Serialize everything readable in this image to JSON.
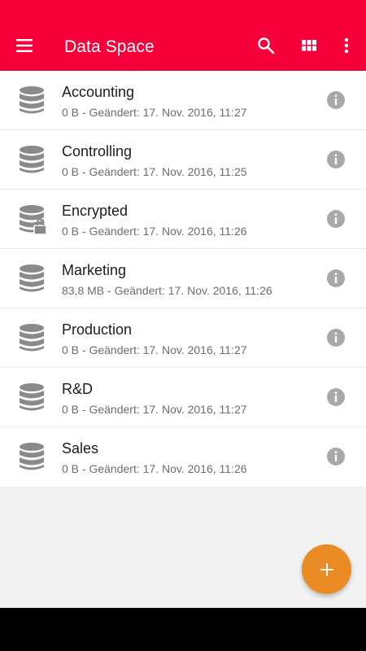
{
  "app_bar": {
    "title": "Data Space",
    "background": "#f5003b",
    "icons": [
      "menu-icon",
      "search-icon",
      "grid-view-icon",
      "more-vert-icon"
    ]
  },
  "spaces": [
    {
      "name": "Accounting",
      "meta": "0 B - Geändert: 17. Nov. 2016, 11:27",
      "encrypted": false
    },
    {
      "name": "Controlling",
      "meta": "0 B - Geändert: 17. Nov. 2016, 11:25",
      "encrypted": false
    },
    {
      "name": "Encrypted",
      "meta": "0 B - Geändert: 17. Nov. 2016, 11:26",
      "encrypted": true
    },
    {
      "name": "Marketing",
      "meta": "83,8 MB - Geändert: 17. Nov. 2016, 11:26",
      "encrypted": false
    },
    {
      "name": "Production",
      "meta": "0 B - Geändert: 17. Nov. 2016, 11:27",
      "encrypted": false
    },
    {
      "name": "R&D",
      "meta": "0 B - Geändert: 17. Nov. 2016, 11:27",
      "encrypted": false
    },
    {
      "name": "Sales",
      "meta": "0 B - Geändert: 17. Nov. 2016, 11:26",
      "encrypted": false
    }
  ],
  "fab": {
    "icon": "plus-icon",
    "color": "#ea8c23"
  },
  "colors": {
    "icon_gray": "#8a8a8a",
    "info_gray": "#a8a8a8"
  }
}
